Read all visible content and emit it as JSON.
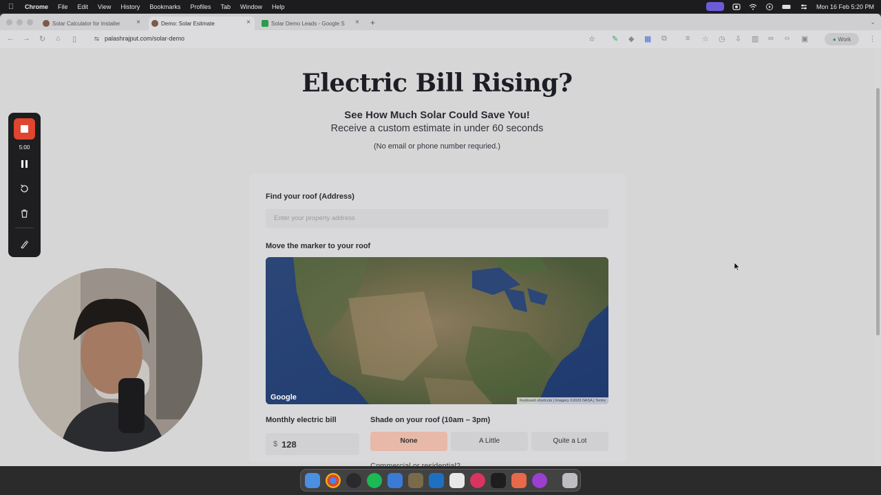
{
  "menubar": {
    "app_name": "Chrome",
    "items": [
      "File",
      "Edit",
      "View",
      "History",
      "Bookmarks",
      "Profiles",
      "Tab",
      "Window",
      "Help"
    ],
    "datetime": "Mon 16 Feb  5:20 PM"
  },
  "browser": {
    "tabs": [
      {
        "title": "Solar Calculator for Installer",
        "favicon": "avatar-favicon",
        "active": false
      },
      {
        "title": "Demo: Solar Esitmate",
        "favicon": "avatar-favicon",
        "active": true
      },
      {
        "title": "Solar Demo Leads - Google S",
        "favicon": "sheets-favicon",
        "active": false
      }
    ],
    "url": "palashrajput.com/solar-demo",
    "profile_label": "Work"
  },
  "page": {
    "headline": "Electric Bill Rising?",
    "subheadline": "See How Much Solar Could Save You!",
    "tagline": "Receive a custom estimate in under 60 seconds",
    "note": "(No email or phone number requried.)",
    "address_label": "Find your roof (Address)",
    "address_placeholder": "Enter your property address",
    "map_label": "Move the marker to your roof",
    "map_logo": "Google",
    "map_attribution": "Keyboard shortcuts  |  Imagery ©2026 NASA  |  Terms",
    "bill_label": "Monthly electric bill",
    "bill_currency": "$",
    "bill_value": "128",
    "shade_label": "Shade on your roof (10am – 3pm)",
    "shade_options": [
      "None",
      "A Little",
      "Quite a Lot"
    ],
    "shade_selected": "None",
    "next_question_partial": "Commercial or residential?"
  },
  "recorder": {
    "timer": "5:00"
  },
  "colors": {
    "accent_stop": "#e0452f",
    "shade_selected_bg": "#e8b8a8"
  }
}
